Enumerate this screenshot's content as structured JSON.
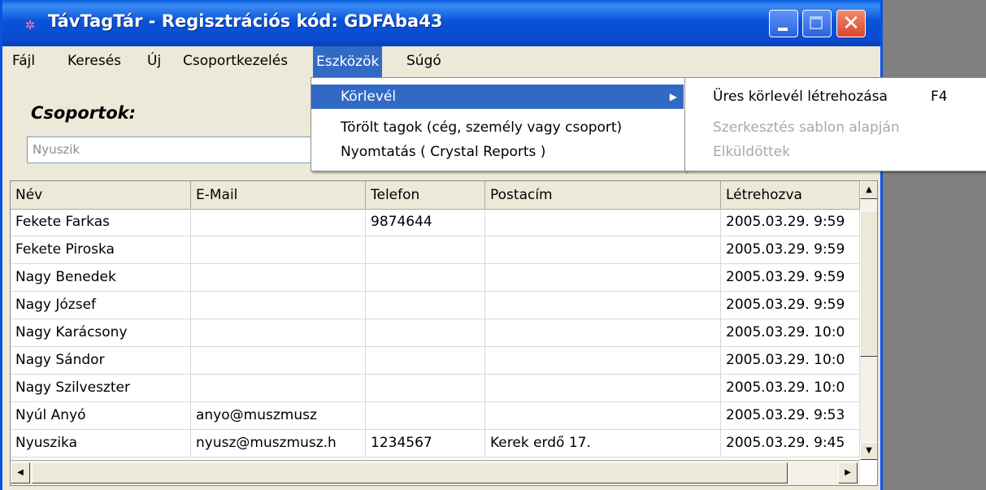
{
  "window": {
    "title": "TávTagTár - Regisztrációs kód: GDFAba43",
    "app_icon": "app-logo-icon",
    "close_symbol": "✕"
  },
  "menubar": {
    "items": [
      "Fájl",
      "Keresés",
      "Új",
      "Csoportkezelés",
      "Eszközök",
      "Súgó"
    ],
    "active": "Eszközök"
  },
  "groups": {
    "label": "Csoportok:",
    "selected": "Nyuszik"
  },
  "table": {
    "columns": [
      "Név",
      "E-Mail",
      "Telefon",
      "Postacím",
      "Létrehozva"
    ],
    "rows": [
      [
        "Fekete Farkas",
        "",
        "9874644",
        "",
        "2005.03.29. 9:59"
      ],
      [
        "Fekete Piroska",
        "",
        "",
        "",
        "2005.03.29. 9:59"
      ],
      [
        "Nagy Benedek",
        "",
        "",
        "",
        "2005.03.29. 9:59"
      ],
      [
        "Nagy József",
        "",
        "",
        "",
        "2005.03.29. 9:59"
      ],
      [
        "Nagy Karácsony",
        "",
        "",
        "",
        "2005.03.29. 10:0"
      ],
      [
        "Nagy Sándor",
        "",
        "",
        "",
        "2005.03.29. 10:0"
      ],
      [
        "Nagy Szilveszter",
        "",
        "",
        "",
        "2005.03.29. 10:0"
      ],
      [
        "Nyúl Anyó",
        "anyo@muszmusz",
        "",
        "",
        "2005.03.29. 9:53"
      ],
      [
        "Nyuszika",
        "nyusz@muszmusz.h",
        "1234567",
        "Kerek erdő 17.",
        "2005.03.29. 9:45"
      ]
    ]
  },
  "eszkozok_menu": {
    "items": [
      "Körlevél",
      "Törölt tagok (cég, személy vagy csoport)",
      "Nyomtatás ( Crystal Reports )"
    ],
    "highlighted": "Körlevél"
  },
  "korlevel_submenu": {
    "items": [
      {
        "label": "Üres körlevél létrehozása",
        "shortcut": "F4",
        "enabled": true
      },
      {
        "label": "Szerkesztés sablon alapján",
        "shortcut": "",
        "enabled": false
      },
      {
        "label": "Elküldöttek",
        "shortcut": "",
        "enabled": false
      }
    ]
  },
  "colors": {
    "titlebar": "#0a53d8",
    "menu_highlight": "#316ac5",
    "window_bg": "#ece9d8",
    "desktop": "#808080"
  }
}
